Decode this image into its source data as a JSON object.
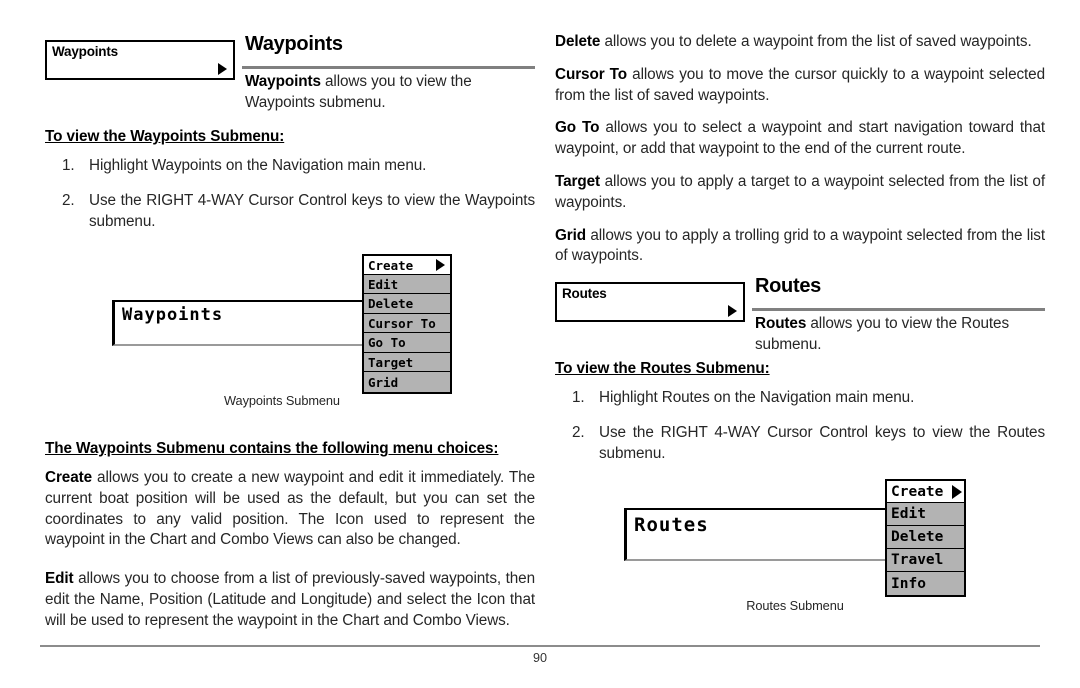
{
  "page": {
    "number": "90"
  },
  "left_column": {
    "section": {
      "chip_label": "Waypoints",
      "title": "Waypoints",
      "description_bold": "Waypoints",
      "description_rest": " allows you to view the Waypoints submenu."
    },
    "howto_heading": "To view the Waypoints Submenu:",
    "steps": [
      {
        "num": "1.",
        "text": "Highlight Waypoints on the Navigation main menu."
      },
      {
        "num": "2.",
        "text": "Use the RIGHT 4-WAY Cursor Control keys to view the Waypoints submenu."
      }
    ],
    "figure": {
      "panel_label": "Waypoints",
      "caption": "Waypoints Submenu",
      "menu_items": [
        {
          "label": "Create",
          "selected": true,
          "has_submenu_arrow": true
        },
        {
          "label": "Edit",
          "selected": false,
          "has_submenu_arrow": false
        },
        {
          "label": "Delete",
          "selected": false,
          "has_submenu_arrow": false
        },
        {
          "label": "Cursor To",
          "selected": false,
          "has_submenu_arrow": false
        },
        {
          "label": "Go To",
          "selected": false,
          "has_submenu_arrow": false
        },
        {
          "label": "Target",
          "selected": false,
          "has_submenu_arrow": false
        },
        {
          "label": "Grid",
          "selected": false,
          "has_submenu_arrow": false
        }
      ]
    },
    "choices_heading": "The Waypoints Submenu contains the following menu choices:",
    "choices": [
      {
        "term": "Create",
        "text": " allows you to create a new waypoint and edit it immediately. The current boat position will be used as the default, but you can set the coordinates to any valid position. The Icon used to represent the waypoint in the Chart and Combo Views can also be changed."
      },
      {
        "term": "Edit",
        "text": " allows you to choose from a list of previously-saved waypoints, then edit the Name, Position (Latitude and Longitude) and select the Icon that will be used to represent the waypoint in the Chart and Combo Views."
      }
    ]
  },
  "right_column": {
    "choices": [
      {
        "term": "Delete",
        "text": " allows you to delete a waypoint from the list of saved waypoints."
      },
      {
        "term": "Cursor To",
        "text": " allows you to move the cursor quickly to a waypoint selected from the list of saved waypoints."
      },
      {
        "term": "Go To",
        "text": " allows you to select a waypoint and start navigation toward that waypoint, or add that waypoint to the end of the current route."
      },
      {
        "term": "Target",
        "text": " allows you to apply a target to a waypoint selected from the list of waypoints."
      },
      {
        "term": "Grid",
        "text": " allows you to apply a trolling grid to a waypoint selected from the list of waypoints."
      }
    ],
    "section": {
      "chip_label": "Routes",
      "title": "Routes",
      "description_bold": "Routes",
      "description_rest": " allows you to view the Routes submenu."
    },
    "howto_heading": "To view the Routes Submenu:",
    "steps": [
      {
        "num": "1.",
        "text": "Highlight Routes on the Navigation main menu."
      },
      {
        "num": "2.",
        "text": "Use the RIGHT 4-WAY Cursor Control keys to view the Routes submenu."
      }
    ],
    "figure": {
      "panel_label": "Routes",
      "caption": "Routes Submenu",
      "menu_items": [
        {
          "label": "Create",
          "selected": true,
          "has_submenu_arrow": true
        },
        {
          "label": "Edit",
          "selected": false,
          "has_submenu_arrow": false
        },
        {
          "label": "Delete",
          "selected": false,
          "has_submenu_arrow": false
        },
        {
          "label": "Travel",
          "selected": false,
          "has_submenu_arrow": false
        },
        {
          "label": "Info",
          "selected": false,
          "has_submenu_arrow": false
        }
      ]
    }
  },
  "colors": {
    "menu_fill": "#b3b3b3",
    "menu_selected_fill": "#ffffff",
    "border": "#000000",
    "rule": "#808080",
    "text": "#262626"
  }
}
